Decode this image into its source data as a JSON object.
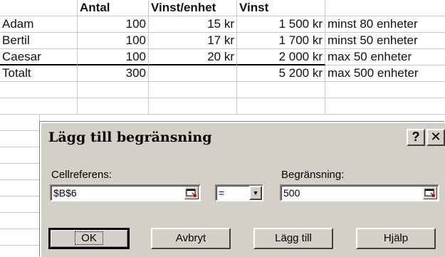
{
  "sheet": {
    "header": {
      "c0": "",
      "c1": "Antal",
      "c2": "Vinst/enhet",
      "c3": "Vinst",
      "c4": ""
    },
    "rows": [
      {
        "name": "Adam",
        "antal": "100",
        "vinst_enhet": "15 kr",
        "vinst": "1 500 kr",
        "note": "minst 80 enheter"
      },
      {
        "name": "Bertil",
        "antal": "100",
        "vinst_enhet": "17 kr",
        "vinst": "1 700 kr",
        "note": "minst 50 enheter"
      },
      {
        "name": "Caesar",
        "antal": "100",
        "vinst_enhet": "20 kr",
        "vinst": "2 000 kr",
        "note": "max 50 enheter"
      }
    ],
    "total": {
      "name": "Totalt",
      "antal": "300",
      "vinst_enhet": "",
      "vinst": "5 200 kr",
      "note": "max 500 enheter"
    }
  },
  "dialog": {
    "title": "Lägg till begränsning",
    "help_glyph": "?",
    "close_glyph": "✕",
    "cellref_label": "Cellreferens:",
    "cellref_value": "$B$6",
    "operator_value": "=",
    "constraint_label": "Begränsning:",
    "constraint_value": "500",
    "buttons": {
      "ok": "OK",
      "cancel": "Avbryt",
      "add": "Lägg till",
      "help": "Hjälp"
    },
    "icons": {
      "collapse": "collapse-dialog-icon",
      "dropdown": "chevron-down-icon"
    }
  }
}
